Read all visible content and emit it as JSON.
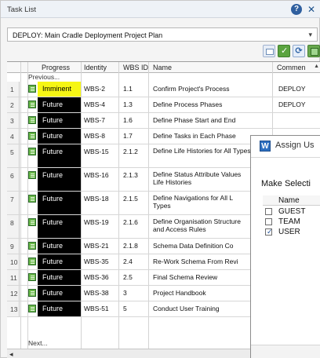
{
  "panel": {
    "title": "Task List",
    "help_icon": "?",
    "close_icon": "✕"
  },
  "plan_select": {
    "value": "DEPLOY: Main Cradle Deployment Project Plan",
    "chevron": "▾"
  },
  "toolbar": {
    "buttons": [
      {
        "name": "table-icon"
      },
      {
        "name": "check-icon"
      },
      {
        "name": "refresh-icon",
        "glyph": "⟳"
      },
      {
        "name": "export-icon"
      }
    ]
  },
  "grid": {
    "columns": [
      "Progress",
      "Identity",
      "WBS ID",
      "Name",
      "Commen"
    ],
    "previous_label": "Previous...",
    "next_label": "Next...",
    "scroll_up": "▲",
    "scroll_left": "◂",
    "rows": [
      {
        "num": "1",
        "progress": "Imminent",
        "identity": "WBS-2",
        "wbs": "1.1",
        "name": "Confirm Project's Process",
        "comment": "DEPLOY"
      },
      {
        "num": "2",
        "progress": "Future",
        "identity": "WBS-4",
        "wbs": "1.3",
        "name": "Define Process Phases",
        "comment": "DEPLOY"
      },
      {
        "num": "3",
        "progress": "Future",
        "identity": "WBS-7",
        "wbs": "1.6",
        "name": "Define Phase Start and End",
        "comment": ""
      },
      {
        "num": "4",
        "progress": "Future",
        "identity": "WBS-8",
        "wbs": "1.7",
        "name": "Define Tasks in Each Phase",
        "comment": ""
      },
      {
        "num": "5",
        "progress": "Future",
        "identity": "WBS-15",
        "wbs": "2.1.2",
        "name": "Define Life Histories for All Types",
        "comment": ""
      },
      {
        "num": "6",
        "progress": "Future",
        "identity": "WBS-16",
        "wbs": "2.1.3",
        "name": "Define Status Attribute Values Life Histories",
        "comment": ""
      },
      {
        "num": "7",
        "progress": "Future",
        "identity": "WBS-18",
        "wbs": "2.1.5",
        "name": "Define Navigations for All L Types",
        "comment": ""
      },
      {
        "num": "8",
        "progress": "Future",
        "identity": "WBS-19",
        "wbs": "2.1.6",
        "name": "Define Organisation Structure and Access Rules",
        "comment": ""
      },
      {
        "num": "9",
        "progress": "Future",
        "identity": "WBS-21",
        "wbs": "2.1.8",
        "name": "Schema Data Definition Co",
        "comment": ""
      },
      {
        "num": "10",
        "progress": "Future",
        "identity": "WBS-35",
        "wbs": "2.4",
        "name": "Re-Work Schema From Revi",
        "comment": ""
      },
      {
        "num": "11",
        "progress": "Future",
        "identity": "WBS-36",
        "wbs": "2.5",
        "name": "Final Schema Review",
        "comment": ""
      },
      {
        "num": "12",
        "progress": "Future",
        "identity": "WBS-38",
        "wbs": "3",
        "name": "Project Handbook",
        "comment": ""
      },
      {
        "num": "13",
        "progress": "Future",
        "identity": "WBS-51",
        "wbs": "5",
        "name": "Conduct User Training",
        "comment": ""
      }
    ]
  },
  "dialog": {
    "icon_letter": "W",
    "title": "Assign Us",
    "make_selection": "Make Selecti",
    "list_header": "Name",
    "items": [
      {
        "label": "GUEST",
        "checked": false
      },
      {
        "label": "TEAM",
        "checked": false
      },
      {
        "label": "USER",
        "checked": true
      }
    ]
  }
}
